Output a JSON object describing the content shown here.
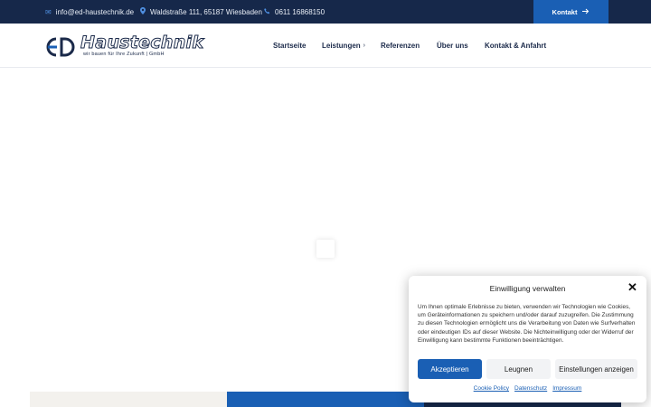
{
  "topbar": {
    "email": "info@ed-haustechnik.de",
    "address": "Waldstraße 111, 65187 Wiesbaden",
    "phone": "0611 16868150",
    "contact_button": "Kontakt",
    "icons": [
      "mail-icon",
      "location-pin-icon",
      "phone-icon",
      "arrow-right-icon"
    ]
  },
  "logo": {
    "brand": "Haustechnik",
    "tagline": "wir bauen für Ihre Zukunft | GmbH",
    "mark": "ED"
  },
  "nav": {
    "items": [
      {
        "label": "Startseite"
      },
      {
        "label": "Leistungen",
        "has_submenu": true
      },
      {
        "label": "Referenzen"
      },
      {
        "label": "Über uns"
      },
      {
        "label": "Kontakt & Anfahrt"
      }
    ]
  },
  "cookie_dialog": {
    "title": "Einwilligung verwalten",
    "message": "Um Ihnen optimale Erlebnisse zu bieten, verwenden wir Technologien wie Cookies, um Geräteinformationen zu speichern und/oder darauf zuzugreifen. Die Zustimmung zu diesen Technologien ermöglicht uns die Verarbeitung von Daten wie Surfverhalten oder eindeutigen IDs auf dieser Website. Die Nichteinwilligung oder der Widerruf der Einwilligung kann bestimmte Funktionen beeinträchtigen.",
    "accept": "Akzeptieren",
    "deny": "Leugnen",
    "preferences": "Einstellungen anzeigen",
    "links": [
      "Cookie Policy",
      "Datenschutz",
      "Impressum"
    ]
  },
  "colors": {
    "topbar_bg": "#16284a",
    "accent": "#1a5fb4",
    "strip_left": "#f3f1ed",
    "strip_middle": "#1a5fb4",
    "strip_right": "#16284a"
  }
}
